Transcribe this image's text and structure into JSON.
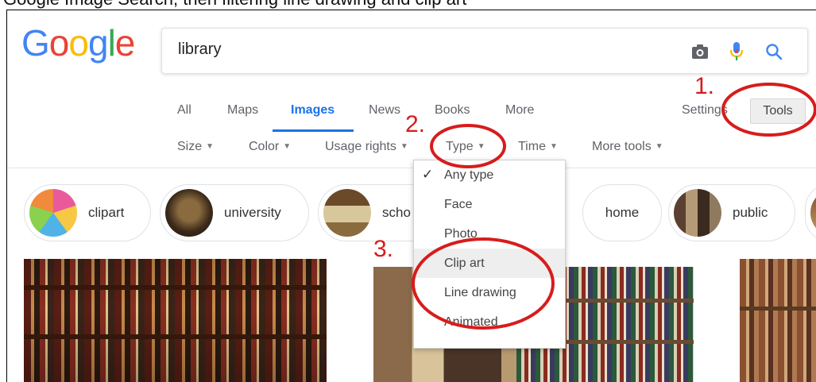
{
  "caption": "Google Image Search, then filtering line drawing and clip art",
  "logo": [
    "G",
    "o",
    "o",
    "g",
    "l",
    "e"
  ],
  "logo_colors": [
    "#4285F4",
    "#EA4335",
    "#FBBC05",
    "#4285F4",
    "#34A853",
    "#EA4335"
  ],
  "search": {
    "value": "library"
  },
  "search_icons": [
    "camera-icon",
    "microphone-icon",
    "search-icon"
  ],
  "tabs": [
    {
      "label": "All",
      "active": false
    },
    {
      "label": "Maps",
      "active": false
    },
    {
      "label": "Images",
      "active": true
    },
    {
      "label": "News",
      "active": false
    },
    {
      "label": "Books",
      "active": false
    },
    {
      "label": "More",
      "active": false
    }
  ],
  "settings_label": "Settings",
  "tools_label": "Tools",
  "filters": [
    "Size",
    "Color",
    "Usage rights",
    "Type",
    "Time",
    "More tools"
  ],
  "chips": [
    "clipart",
    "university",
    "scho",
    "home",
    "public"
  ],
  "type_menu": [
    {
      "label": "Any type",
      "checked": true
    },
    {
      "label": "Face",
      "checked": false
    },
    {
      "label": "Photo",
      "checked": false
    },
    {
      "label": "Clip art",
      "checked": false,
      "highlighted": true
    },
    {
      "label": "Line drawing",
      "checked": false
    },
    {
      "label": "Animated",
      "checked": false
    }
  ],
  "annotations": [
    "1.",
    "2.",
    "3."
  ],
  "colors": {
    "accent": "#1a73e8",
    "annotation": "#d71c1c"
  }
}
